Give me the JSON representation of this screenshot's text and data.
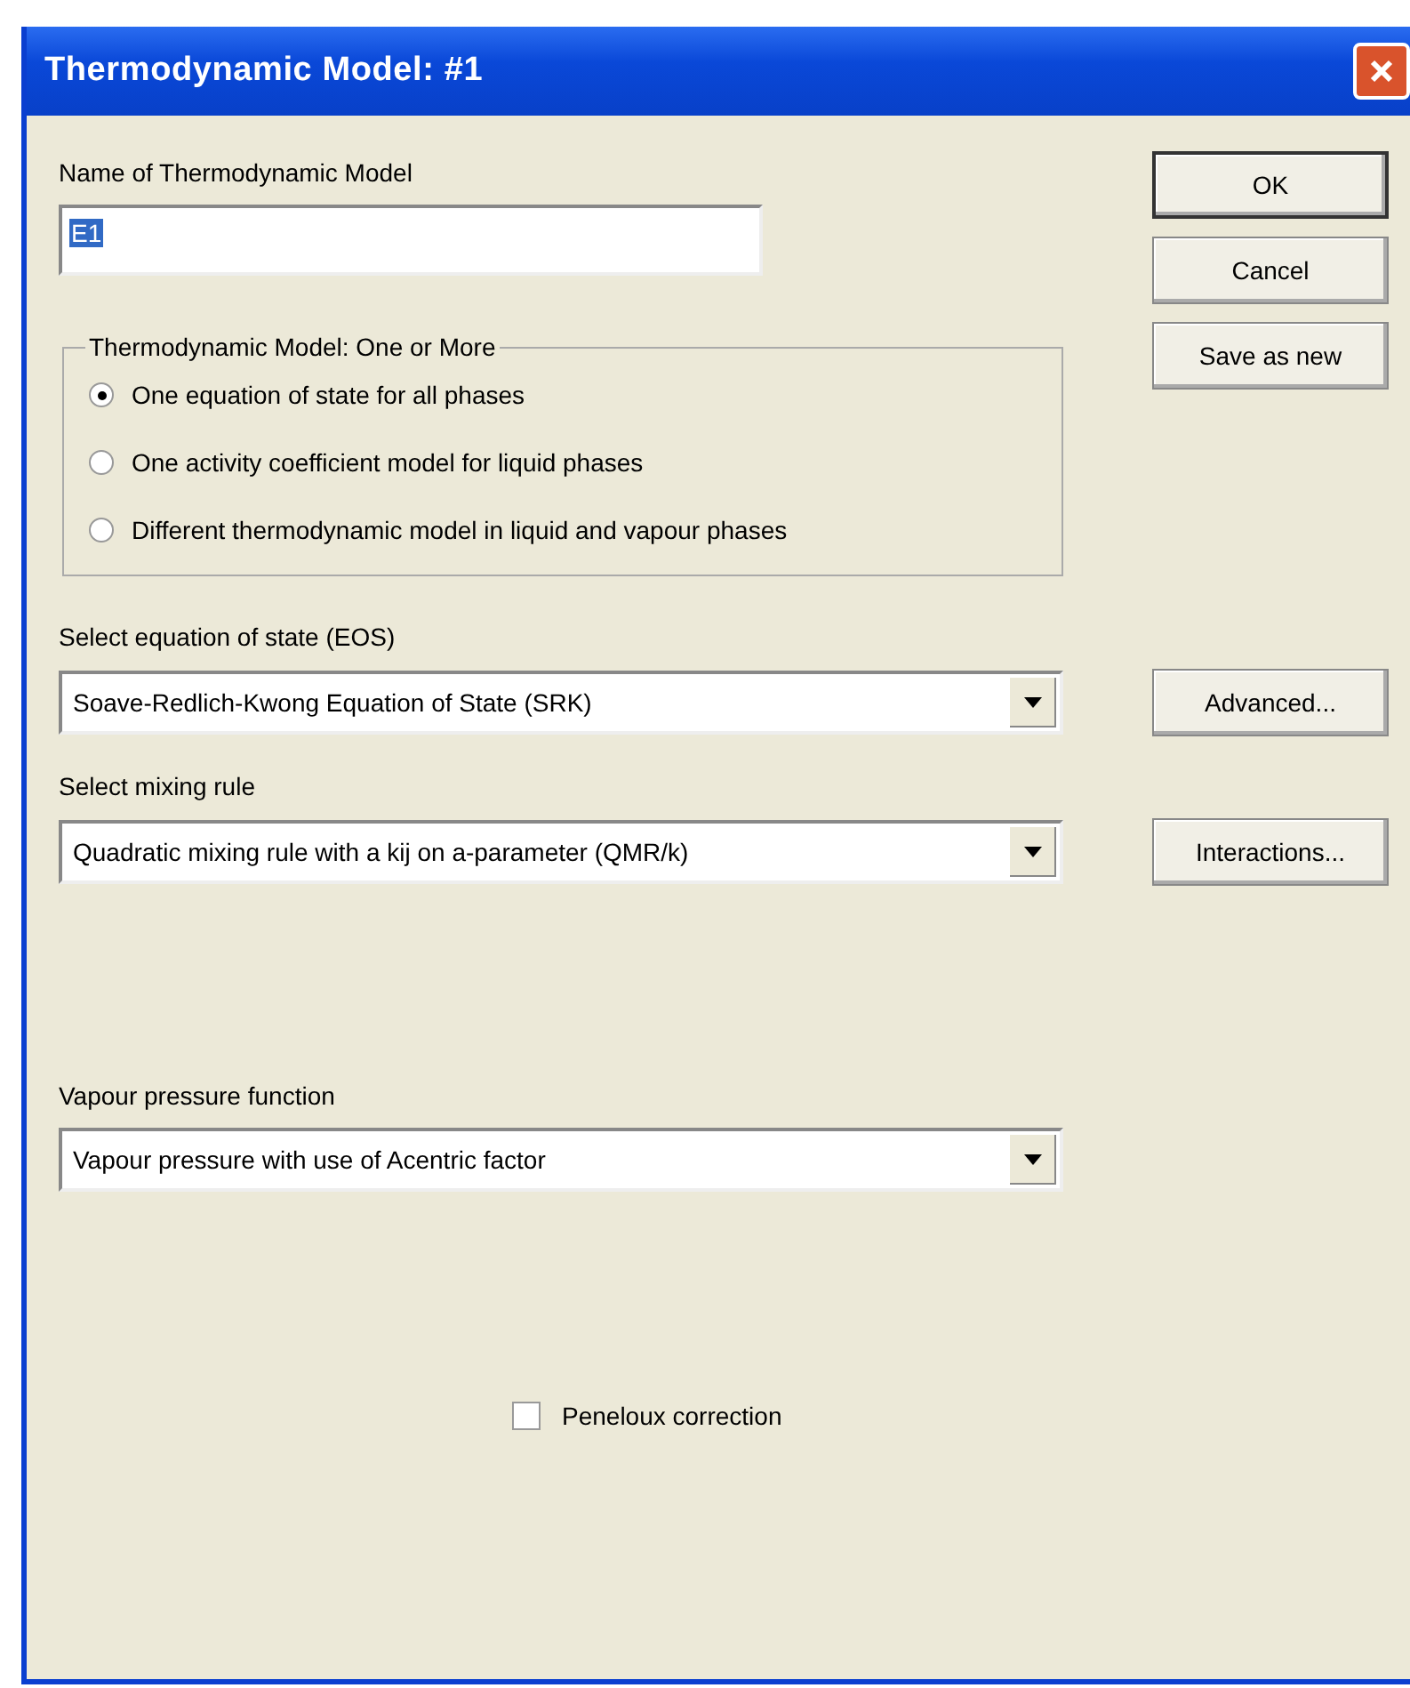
{
  "window": {
    "title": "Thermodynamic Model:  #1"
  },
  "name_field": {
    "label": "Name of Thermodynamic Model",
    "value": "E1"
  },
  "model_group": {
    "title": "Thermodynamic Model: One or More",
    "options": [
      {
        "label": "One equation of state for all phases",
        "selected": true
      },
      {
        "label": "One activity coefficient model for liquid phases",
        "selected": false
      },
      {
        "label": "Different thermodynamic model in liquid and vapour phases",
        "selected": false
      }
    ]
  },
  "buttons": [
    "OK",
    "Cancel",
    "Save as new"
  ],
  "eos": {
    "label": "Select equation of state (EOS)",
    "value": "Soave-Redlich-Kwong Equation of State (SRK)",
    "button": "Advanced..."
  },
  "mixing_rule": {
    "label": "Select mixing rule",
    "value": "Quadratic mixing rule with a kij on a-parameter (QMR/k)",
    "button": "Interactions..."
  },
  "vapour_pressure": {
    "label": "Vapour pressure function",
    "value": "Vapour pressure with use of Acentric factor"
  },
  "peneloux": {
    "label": "Peneloux correction",
    "checked": false
  }
}
